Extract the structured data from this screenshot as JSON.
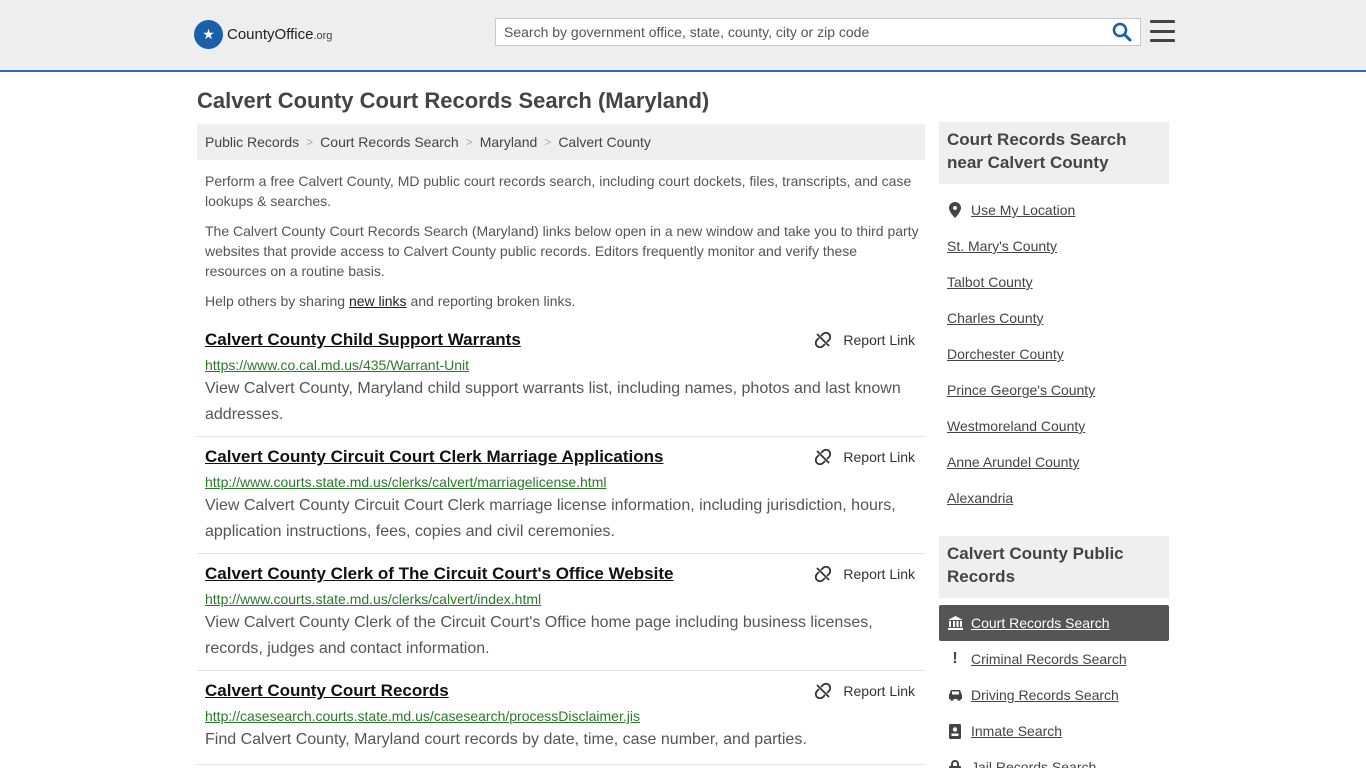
{
  "header": {
    "logo_main": "CountyOffice",
    "logo_suffix": ".org",
    "search_placeholder": "Search by government office, state, county, city or zip code"
  },
  "page_title": "Calvert County Court Records Search (Maryland)",
  "breadcrumb": [
    "Public Records",
    "Court Records Search",
    "Maryland",
    "Calvert County"
  ],
  "intro": {
    "p1": "Perform a free Calvert County, MD public court records search, including court dockets, files, transcripts, and case lookups & searches.",
    "p2": "The Calvert County Court Records Search (Maryland) links below open in a new window and take you to third party websites that provide access to Calvert County public records. Editors frequently monitor and verify these resources on a routine basis.",
    "p3_before": "Help others by sharing ",
    "p3_link": "new links",
    "p3_after": " and reporting broken links."
  },
  "report_label": "Report Link",
  "listings": [
    {
      "title": "Calvert County Child Support Warrants",
      "url": "https://www.co.cal.md.us/435/Warrant-Unit",
      "desc": "View Calvert County, Maryland child support warrants list, including names, photos and last known addresses."
    },
    {
      "title": "Calvert County Circuit Court Clerk Marriage Applications",
      "url": "http://www.courts.state.md.us/clerks/calvert/marriagelicense.html",
      "desc": "View Calvert County Circuit Court Clerk marriage license information, including jurisdiction, hours, application instructions, fees, copies and civil ceremonies."
    },
    {
      "title": "Calvert County Clerk of The Circuit Court's Office Website",
      "url": "http://www.courts.state.md.us/clerks/calvert/index.html",
      "desc": "View Calvert County Clerk of the Circuit Court's Office home page including business licenses, records, judges and contact information."
    },
    {
      "title": "Calvert County Court Records",
      "url": "http://casesearch.courts.state.md.us/casesearch/processDisclaimer.jis",
      "desc": "Find Calvert County, Maryland court records by date, time, case number, and parties."
    }
  ],
  "sidebar": {
    "nearby_heading": "Court Records Search near Calvert County",
    "use_location": "Use My Location",
    "nearby": [
      "St. Mary's County",
      "Talbot County",
      "Charles County",
      "Dorchester County",
      "Prince George's County",
      "Westmoreland County",
      "Anne Arundel County",
      "Alexandria"
    ],
    "public_heading": "Calvert County Public Records",
    "public_items": [
      {
        "label": "Court Records Search",
        "icon": "courthouse-icon",
        "active": true
      },
      {
        "label": "Criminal Records Search",
        "icon": "exclamation-icon",
        "active": false
      },
      {
        "label": "Driving Records Search",
        "icon": "car-icon",
        "active": false
      },
      {
        "label": "Inmate Search",
        "icon": "id-card-icon",
        "active": false
      },
      {
        "label": "Jail Records Search",
        "icon": "lock-icon",
        "active": false
      }
    ]
  },
  "colors": {
    "header_bg": "#eeeeee",
    "accent": "#2b6cb0",
    "url_green": "#2a7a2a",
    "active_item_bg": "#555555"
  }
}
